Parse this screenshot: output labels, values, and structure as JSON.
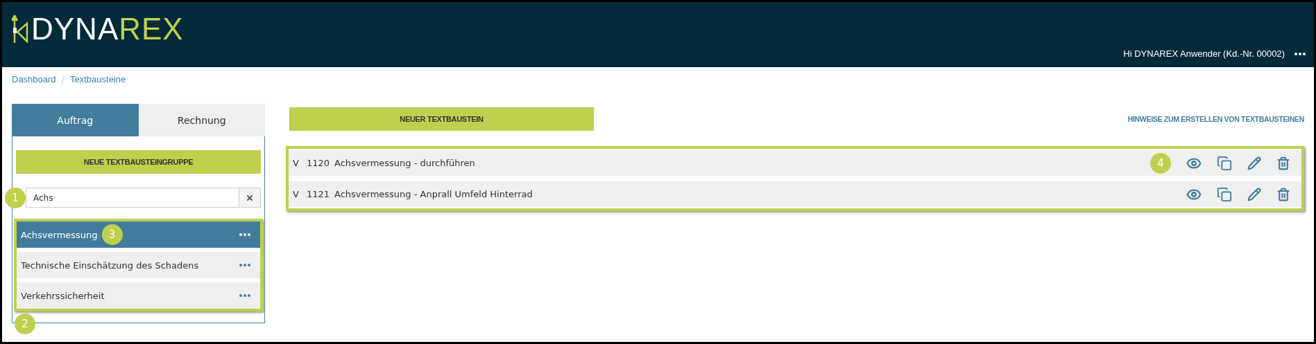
{
  "header": {
    "logo": {
      "part_1": "DYNA",
      "part_2": "REX"
    },
    "greeting": "Hi DYNAREX Anwender (Kd.-Nr. 00002)"
  },
  "breadcrumb": [
    "Dashboard",
    "Textbausteine"
  ],
  "breadcrumb_separator": "/",
  "tabs": [
    {
      "label": "Auftrag",
      "selected": true
    },
    {
      "label": "Rechnung",
      "selected": false
    }
  ],
  "new_group_button": "NEUE TEXTBAUSTEINGRUPPE",
  "search": {
    "value": "Achs",
    "callout": "1"
  },
  "group_list_callout": "2",
  "groups": [
    {
      "label": "Achsvermessung",
      "selected": true,
      "callout": "3"
    },
    {
      "label": "Technische Einschätzung des Schadens",
      "selected": false
    },
    {
      "label": "Verkehrssicherheit",
      "selected": false
    }
  ],
  "new_block_button": "NEUER TEXTBAUSTEIN",
  "hint_link": "HINWEISE ZUM ERSTELLEN VON TEXTBAUSTEINEN",
  "blocks": [
    {
      "type": "V",
      "number": "1120",
      "title": "Achsvermessung - durchführen",
      "callout": "4"
    },
    {
      "type": "V",
      "number": "1121",
      "title": "Achsvermessung - Anprall Umfeld Hinterrad"
    }
  ]
}
